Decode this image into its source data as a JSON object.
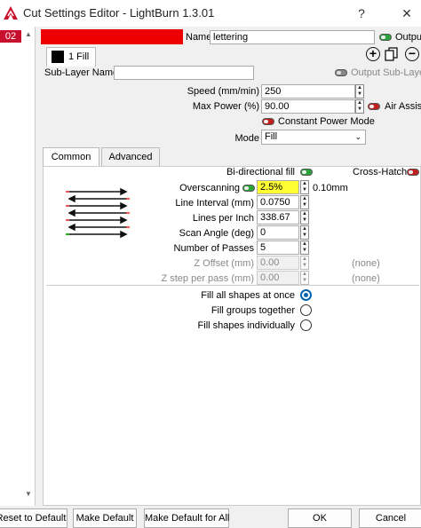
{
  "window": {
    "title": "Cut Settings Editor - LightBurn 1.3.01",
    "help_glyph": "?",
    "close_glyph": "✕"
  },
  "layer": {
    "index": "02",
    "color": "#ee0000",
    "name_label": "Name",
    "name_value": "lettering",
    "output_label": "Output"
  },
  "sublayer": {
    "tab_label": "1 Fill",
    "name_label": "Sub-Layer Name",
    "name_value": "",
    "output_label": "Output Sub-Layer",
    "add_glyph": "+",
    "remove_glyph": "−"
  },
  "settings": {
    "speed_label": "Speed (mm/min)",
    "speed_value": "250",
    "power_label": "Max Power (%)",
    "power_value": "90.00",
    "air_assist_label": "Air Assist",
    "constant_power_label": "Constant Power Mode",
    "mode_label": "Mode",
    "mode_value": "Fill"
  },
  "tabs": {
    "common": "Common",
    "advanced": "Advanced"
  },
  "fill": {
    "bidirectional_label": "Bi-directional fill",
    "crosshatch_label": "Cross-Hatch",
    "overscanning_label": "Overscanning",
    "overscanning_value": "2.5%",
    "overscanning_mm": "0.10mm",
    "line_interval_label": "Line Interval (mm)",
    "line_interval_value": "0.0750",
    "lines_per_inch_label": "Lines per Inch",
    "lines_per_inch_value": "338.67",
    "scan_angle_label": "Scan Angle (deg)",
    "scan_angle_value": "0",
    "passes_label": "Number of Passes",
    "passes_value": "5",
    "z_offset_label": "Z Offset (mm)",
    "z_offset_value": "0.00",
    "z_offset_none": "(none)",
    "z_step_label": "Z step per pass (mm)",
    "z_step_value": "0.00",
    "z_step_none": "(none)"
  },
  "fill_options": [
    {
      "label": "Fill all shapes at once",
      "selected": true
    },
    {
      "label": "Fill groups together",
      "selected": false
    },
    {
      "label": "Fill shapes individually",
      "selected": false
    }
  ],
  "buttons": {
    "reset": "Reset to Default",
    "make_default": "Make Default",
    "make_default_all": "Make Default for All",
    "ok": "OK",
    "cancel": "Cancel"
  },
  "colors": {
    "accent": "#0063b1",
    "toggle_on": "#2aa33a",
    "toggle_off": "#c21f1f",
    "highlight": "#ffff33"
  }
}
